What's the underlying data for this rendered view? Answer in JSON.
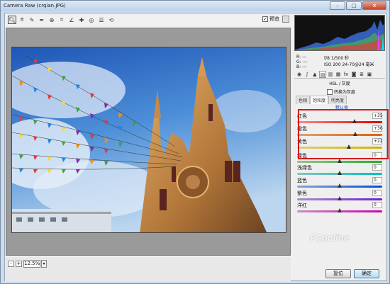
{
  "window": {
    "title": "Camera Raw (crqian.JPG)",
    "minimize": "–",
    "maximize": "□",
    "close": "×"
  },
  "toolbar": {
    "tools": [
      "zoom-tool",
      "hand-tool",
      "white-balance-tool",
      "color-sampler-tool",
      "targeted-adjustment-tool",
      "crop-tool",
      "straighten-tool",
      "retouch-tool",
      "red-eye-tool",
      "preferences-tool"
    ],
    "preview_label": "预览",
    "preview_checked": true
  },
  "zoom": {
    "value": "12.5%",
    "minus": "-",
    "plus": "+"
  },
  "info": {
    "r": "R: ---",
    "g": "G: ---",
    "b": "B: ---",
    "camera_line1": "f/8  1/500 秒",
    "camera_line2": "ISO 200  24-70@24 毫米"
  },
  "panel": {
    "section_title": "HSL / 灰度",
    "grayscale_label": "转换为灰度",
    "subtabs": [
      "色相",
      "饱和度",
      "明亮度"
    ],
    "active_subtab": 1,
    "default_link": "默认值"
  },
  "sliders": [
    {
      "label": "红色",
      "value": "+35",
      "level": 0.675,
      "color1": "#ff8a8a",
      "color2": "#e00000"
    },
    {
      "label": "橙色",
      "value": "+36",
      "level": 0.68,
      "color1": "#e0a070",
      "color2": "#e06000"
    },
    {
      "label": "黄色",
      "value": "+22",
      "level": 0.61,
      "color1": "#dccf80",
      "color2": "#d4b000"
    },
    {
      "label": "绿色",
      "value": "0",
      "level": 0.5,
      "color1": "#9dc08a",
      "color2": "#20b020"
    },
    {
      "label": "浅绿色",
      "value": "0",
      "level": 0.5,
      "color1": "#8ac3c0",
      "color2": "#00c0c0"
    },
    {
      "label": "蓝色",
      "value": "0",
      "level": 0.5,
      "color1": "#8aa3d0",
      "color2": "#0050e0"
    },
    {
      "label": "紫色",
      "value": "0",
      "level": 0.5,
      "color1": "#a890c8",
      "color2": "#7020d0"
    },
    {
      "label": "洋红",
      "value": "0",
      "level": 0.5,
      "color1": "#c890c0",
      "color2": "#d000b0"
    }
  ],
  "buttons": {
    "reset": "复位",
    "ok": "确定"
  },
  "watermark": "PConline"
}
